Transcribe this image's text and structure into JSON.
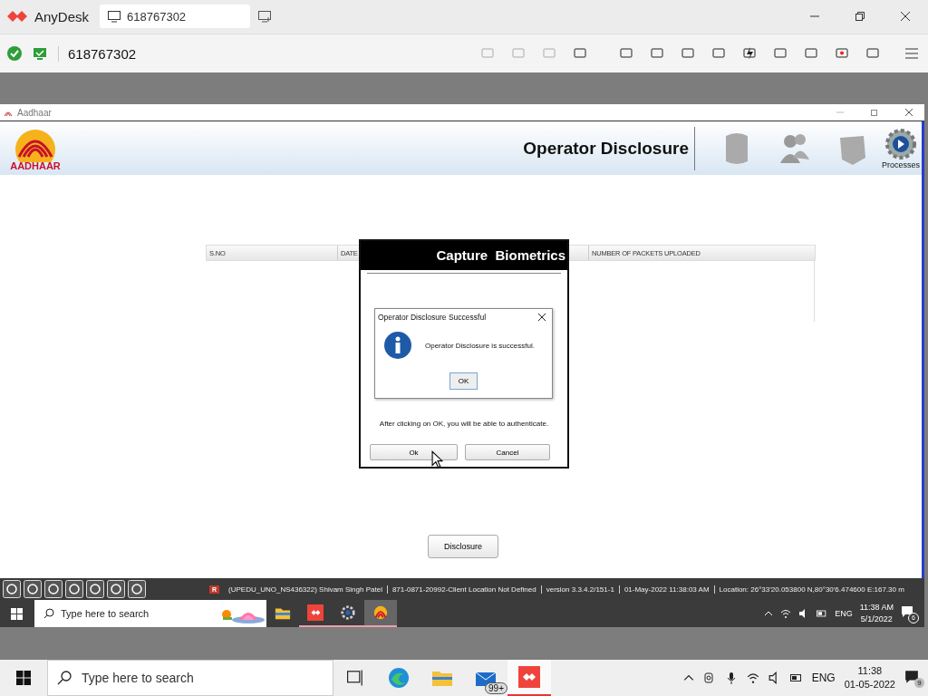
{
  "anydesk": {
    "app_name": "AnyDesk",
    "tab_label": "618767302",
    "address": "618767302"
  },
  "aadhaar_window": {
    "title": "Aadhaar",
    "logo_text": "AADHAAR",
    "header_title": "Operator Disclosure",
    "header_items": [
      {
        "label": "Processes"
      }
    ],
    "table": {
      "columns": [
        "S.NO",
        "DATE",
        "NUMBER OF PACKETS UPLOADED"
      ]
    },
    "disclosure_button": "Disclosure",
    "status_bar": {
      "badge": "R",
      "segments": [
        "(UPEDU_UNO_NS436322) Shivam Singh Patel",
        "871-0871-20992-Client Location Not Defined",
        "version 3.3.4.2/151-1",
        "01-May-2022 11:38:03 AM",
        "Location: 26°33'20.053800 N,80°30'6.474600 E:167.30 m"
      ]
    }
  },
  "capture_dialog": {
    "title": "Capture  Biometrics",
    "note": "After clicking on OK, you will be able to authenticate.",
    "buttons": [
      "Ok",
      "Cancel"
    ]
  },
  "message_box": {
    "title": "Operator Disclosure Successful",
    "message": "Operator Disclosure is successful.",
    "button": "OK"
  },
  "remote_taskbar": {
    "search_placeholder": "Type here to search",
    "apps": [
      {
        "kind": "folder",
        "running": false,
        "active": false
      },
      {
        "kind": "anydesk",
        "running": true,
        "active": false
      },
      {
        "kind": "gear",
        "running": true,
        "active": false
      },
      {
        "kind": "aadhaar",
        "running": true,
        "active": true
      }
    ],
    "language": "ENG",
    "time": "11:38 AM",
    "date": "5/1/2022",
    "notifications": "6"
  },
  "local_taskbar": {
    "search_placeholder": "Type here to search",
    "apps": [
      {
        "kind": "taskview",
        "active": false
      },
      {
        "kind": "edge",
        "active": false
      },
      {
        "kind": "folder",
        "active": false
      },
      {
        "kind": "mail",
        "active": false,
        "badge": "99+"
      },
      {
        "kind": "anydesk",
        "active": true
      }
    ],
    "language": "ENG",
    "time": "11:38",
    "date": "01-05-2022",
    "notifications": "9"
  }
}
